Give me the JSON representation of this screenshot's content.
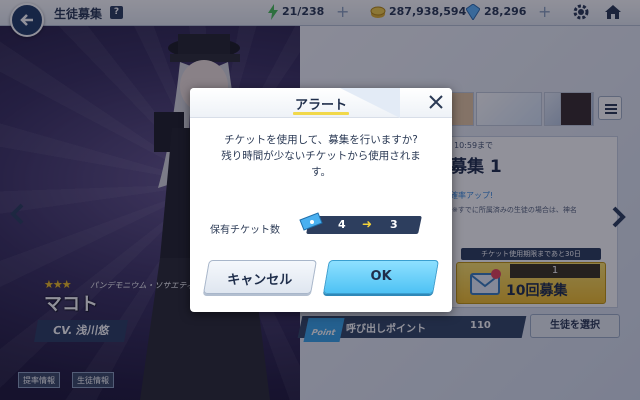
{
  "header": {
    "title": "生徒募集",
    "help": "?",
    "ap": "21/238",
    "credits": "287,938,594",
    "gems": "28,296"
  },
  "character": {
    "stars": "★★★",
    "club": "パンデモニウム・ソサエティー",
    "name": "マコト",
    "cv": "CV. 浅川悠"
  },
  "footer_left": {
    "rates_label": "提率情報",
    "info_label": "生徒情報"
  },
  "gacha": {
    "remaining": "10:59まで",
    "title": "募集 1",
    "pickup": "確率アップ!",
    "note": "※すでに所属済みの生徒の場合は、神名",
    "deadline": "チケット使用期限まであと30日",
    "ticket_count": "1",
    "ten_pull_label": "10回募集"
  },
  "point": {
    "logo": "Point",
    "label": "呼び出しポイント",
    "value": "110"
  },
  "select_student_label": "生徒を選択",
  "modal": {
    "title": "アラート",
    "message_line1": "チケットを使用して、募集を行いますか?",
    "message_line2": "残り時間が少ないチケットから使用されま",
    "message_line3": "す。",
    "ticket_label": "保有チケット数",
    "ticket_before": "4",
    "ticket_arrow": "➜",
    "ticket_after": "3",
    "cancel_label": "キャンセル",
    "ok_label": "OK"
  },
  "colors": {
    "accent_blue": "#4ec2f4",
    "navy": "#2d3e5e",
    "highlight_yellow": "#f1d84a"
  }
}
